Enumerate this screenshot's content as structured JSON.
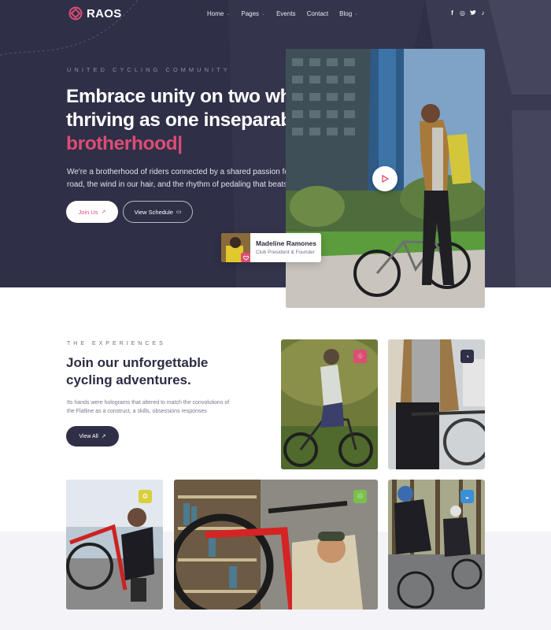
{
  "brand": {
    "name": "RAOS",
    "accent": "#dc4d74",
    "dark": "#2f2f47"
  },
  "nav": {
    "items": [
      {
        "label": "Home",
        "has_dropdown": true
      },
      {
        "label": "Pages",
        "has_dropdown": true
      },
      {
        "label": "Events",
        "has_dropdown": false
      },
      {
        "label": "Contact",
        "has_dropdown": false
      },
      {
        "label": "Blog",
        "has_dropdown": true
      }
    ],
    "dropdown_glyph": "⌄",
    "socials": [
      {
        "icon": "facebook-icon",
        "glyph": "f"
      },
      {
        "icon": "instagram-icon",
        "glyph": "◎"
      },
      {
        "icon": "twitter-icon",
        "glyph": "🐦"
      },
      {
        "icon": "tiktok-icon",
        "glyph": "♪"
      }
    ]
  },
  "hero": {
    "eyebrow": "UNITED CYCLING COMMUNITY",
    "headline_line1": "Embrace unity on two wheels,",
    "headline_line2": "thriving as one inseparable",
    "headline_accent": "brotherhood|",
    "intro": "We're a brotherhood of riders connected by a shared passion for the open road, the wind in our hair, and the rhythm of pedaling that beats in our hearts.",
    "join_label": "Join Us",
    "join_icon": "↗",
    "schedule_label": "View Schedule",
    "schedule_icon": "▭",
    "play_icon": "play-icon",
    "founder_name": "Madeline Ramones",
    "founder_role": "Club President & Founder"
  },
  "experiences": {
    "eyebrow": "THE EXPERIENCES",
    "title_line1": "Join our unforgettable",
    "title_line2": "cycling adventures.",
    "description": "Its hands were holograms that altered to match the convolutions of the Flatline as a construct, a skills, obsessions responses",
    "view_all_label": "View All",
    "view_all_icon": "↗",
    "cards": [
      {
        "name": "mountain-biker-card",
        "badge_icon": "tree-icon",
        "badge_color": "#dc4d74",
        "badge_glyph": "♧"
      },
      {
        "name": "bike-handlebar-card",
        "badge_icon": "speedometer-icon",
        "badge_color": "#2f2f47",
        "badge_glyph": "◔"
      },
      {
        "name": "bike-repair-card",
        "badge_icon": "wrench-icon",
        "badge_color": "#d8cf3c",
        "badge_glyph": "⚙"
      },
      {
        "name": "workshop-card",
        "badge_icon": "cyclist-icon",
        "badge_color": "#7ac04b",
        "badge_glyph": "♲"
      },
      {
        "name": "group-ride-card",
        "badge_icon": "helmet-icon",
        "badge_color": "#3a8fd8",
        "badge_glyph": "◒"
      }
    ]
  }
}
